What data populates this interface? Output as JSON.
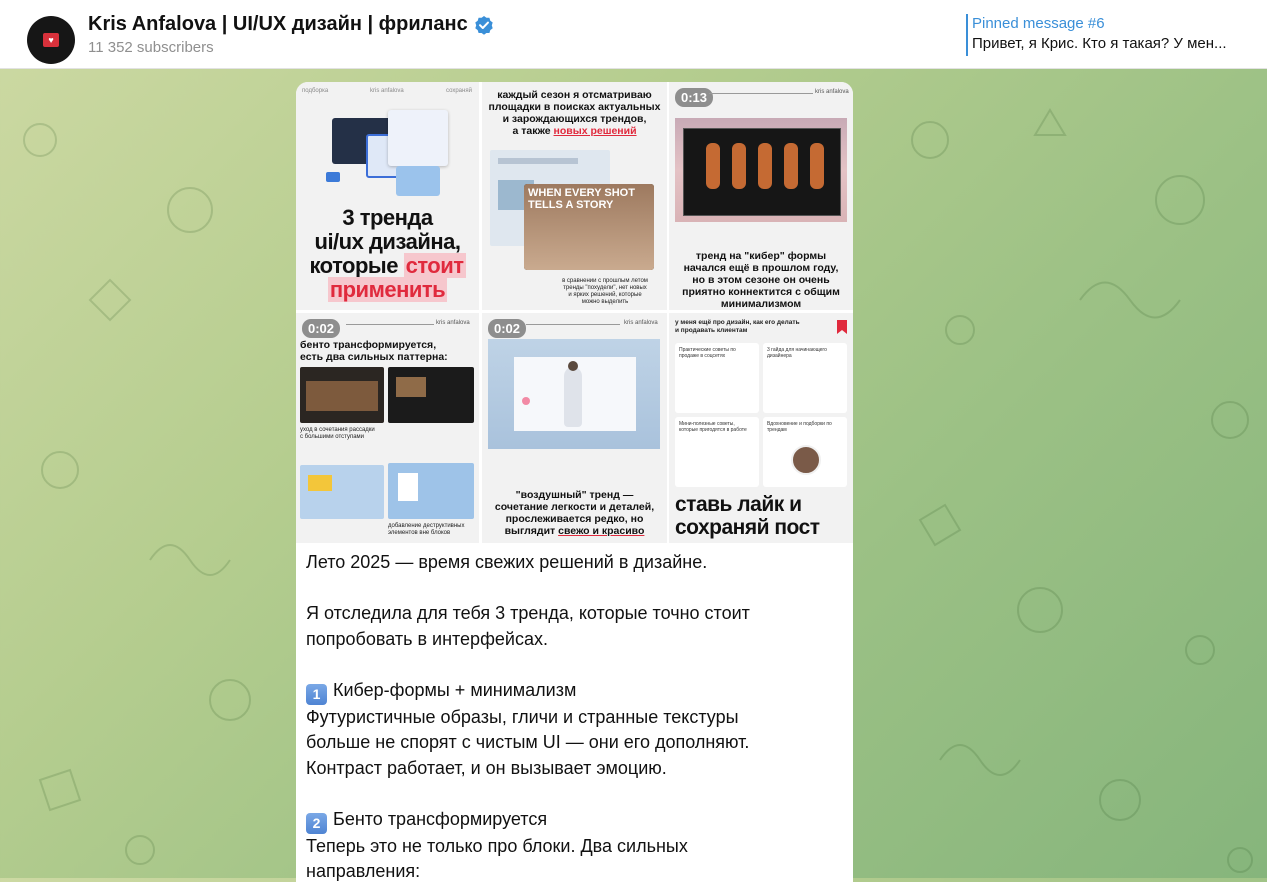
{
  "header": {
    "title": "Kris Anfalova | UI/UX дизайн | фриланс",
    "subscribers": "11 352 subscribers",
    "pinned_title": "Pinned message #6",
    "pinned_text": "Привет, я Крис. Кто я такая? У мен..."
  },
  "colors": {
    "accent": "#3a8fd8",
    "highlight_red": "#e02a3d",
    "highlight_pink": "#f6c7cd",
    "background": "#9cc185"
  },
  "icons": {
    "verified": "verified-badge-icon",
    "bookmark": "bookmark-icon"
  },
  "tiles": {
    "t1": {
      "top_left": "подборка",
      "top_mid": "kris anfalova",
      "top_right": "сохраняй",
      "line1": "3 тренда",
      "line2": "ui/ux дизайна,",
      "line3a": "которые",
      "line3b": "стоит",
      "line4": "применить"
    },
    "t2": {
      "line1": "каждый сезон я отсматриваю",
      "line2": "площадки в поисках актуальных",
      "line3": "и зарождающихся трендов,",
      "line4a": "а также",
      "line4b": "новых решений",
      "screen_text1": "WHEN EVERY SHOT",
      "screen_text2": "TELLS A STORY",
      "caption1": "в сравнении с прошлым летом",
      "caption2": "тренды \"похудели\", нет новых",
      "caption3": "и ярких решений, которые",
      "caption4": "можно выделить"
    },
    "t3": {
      "duration": "0:13",
      "top_right": "kris anfalova",
      "line1": "тренд на \"кибер\" формы",
      "line2": "начался ещё в прошлом году,",
      "line3": "но в этом сезоне он очень",
      "line4": "приятно коннектится с общим",
      "line5": "минимализмом"
    },
    "t4": {
      "duration": "0:02",
      "top_right": "kris anfalova",
      "line1": "бенто трансформируется,",
      "line2": "есть два сильных паттерна:",
      "caption1": "уход в сочетания рассадки",
      "caption2": "с большими отступами",
      "caption3": "добавление деструктивных",
      "caption4": "элементов вне блоков"
    },
    "t5": {
      "duration": "0:02",
      "top_right": "kris anfalova",
      "line1": "\"воздушный\" тренд —",
      "line2": "сочетание легкости и деталей,",
      "line3": "прослеживается редко, но",
      "line4a": "выглядит",
      "line4b": "свежо и красиво"
    },
    "t6": {
      "top1": "у меня ещё про дизайн, как его делать",
      "top2": "и продавать клиентам",
      "card1": "Практические советы по продаже в соцсетях",
      "card2": "3 гайда для начинающего дизайнера",
      "card3": "Мини-полезные советы, которые пригодятся в работе",
      "card4": "Вдохновение и подборки по трендам",
      "line1": "ставь лайк и",
      "line2": "сохраняй пост"
    }
  },
  "post": {
    "p1": "Лето 2025 — время свежих решений в дизайне.",
    "p2_l1": "Я отследила для тебя 3 тренда, которые точно стоит",
    "p2_l2": "попробовать в интерфейсах.",
    "s1_num": "1",
    "s1_title": "Кибер-формы + минимализм",
    "s1_l1": "Футуристичные образы, гличи и странные текстуры",
    "s1_l2": "больше не спорят с чистым UI — они его дополняют.",
    "s1_l3": "Контраст работает, и он вызывает эмоцию.",
    "s2_num": "2",
    "s2_title": "Бенто трансформируется",
    "s2_l1": "Теперь это не только про блоки. Два сильных",
    "s2_l2": "направления:"
  }
}
